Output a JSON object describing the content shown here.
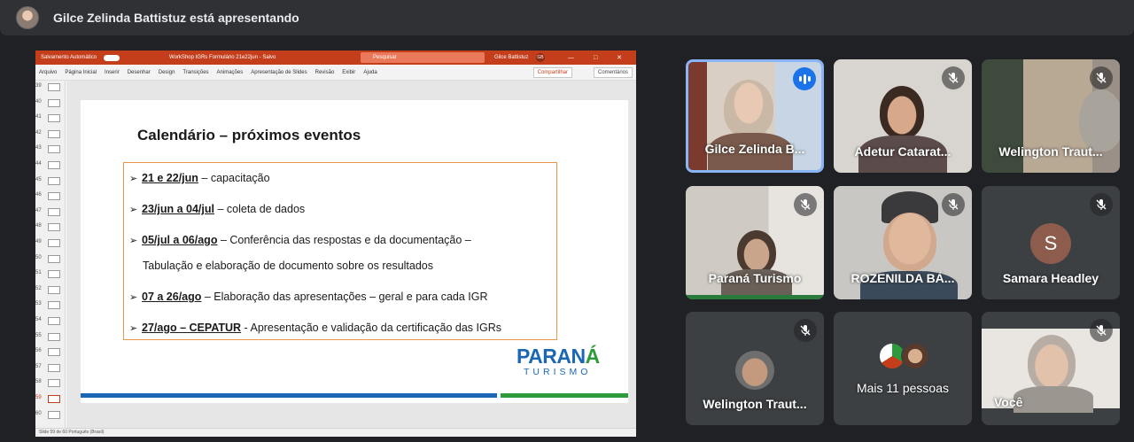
{
  "banner": {
    "presenter_text": "Gilce Zelinda Battistuz está apresentando"
  },
  "powerpoint": {
    "autosave_label": "Salvamento Automático",
    "filename": "WorkShop IGRs Formulário 21e22jun - Salvo",
    "search_placeholder": "Pesquisar",
    "user_name": "Gilce Battistuz",
    "user_initials": "GB",
    "window_buttons": "— □ ✕",
    "menu": [
      "Arquivo",
      "Página Inicial",
      "Inserir",
      "Desenhar",
      "Design",
      "Transições",
      "Animações",
      "Apresentação de Slides",
      "Revisão",
      "Exibir",
      "Ajuda"
    ],
    "share_label": "Compartilhar",
    "comments_label": "Comentários",
    "thumbnail_numbers": [
      "39",
      "40",
      "41",
      "42",
      "43",
      "44",
      "45",
      "46",
      "47",
      "48",
      "49",
      "50",
      "51",
      "52",
      "53",
      "54",
      "55",
      "56",
      "57",
      "58",
      "59",
      "60"
    ],
    "active_slide": "59",
    "status_text": "Slide 59 de 60    Português (Brasil)"
  },
  "slide": {
    "heading": "Calendário – próximos eventos",
    "items": [
      {
        "bold": "21 e 22/jun",
        "rest": " – capacitação"
      },
      {
        "bold": "23/jun a 04/jul",
        "rest": " – coleta de dados"
      },
      {
        "bold": "05/jul a 06/ago",
        "rest": " – Conferência das respostas e da documentação –"
      },
      {
        "bold": "",
        "rest": "Tabulação e elaboração de documento sobre os resultados"
      },
      {
        "bold": "07 a 26/ago",
        "rest": " – Elaboração das apresentações – geral e para cada IGR"
      },
      {
        "bold": "27/ago – CEPATUR",
        "rest": " - Apresentação e validação da certificação das IGRs"
      }
    ],
    "logo_top_a": "PARAN",
    "logo_top_b": "Á",
    "logo_bottom": "TURISMO"
  },
  "participants": [
    {
      "name": "Gilce Zelinda B...",
      "state": "speaking"
    },
    {
      "name": "Adetur Catarat...",
      "state": "muted"
    },
    {
      "name": "Welington Traut...",
      "state": "muted"
    },
    {
      "name": "Paraná Turismo",
      "state": "muted"
    },
    {
      "name": "ROZENILDA BÁ...",
      "state": "muted"
    },
    {
      "name": "Samara Headley",
      "state": "muted",
      "initial": "S"
    },
    {
      "name": "Welington Traut...",
      "state": "muted"
    },
    {
      "name": "Mais 11 pessoas",
      "state": "overflow"
    },
    {
      "name": "Você",
      "state": "muted"
    }
  ],
  "colors": {
    "meet_background": "#202124",
    "tile_background": "#3c4043",
    "speaking_border": "#8ab4f8",
    "ppt_accent": "#c43e1c",
    "slide_box_border": "#e8964c",
    "parana_blue": "#1b67b3",
    "parana_green": "#2e9b3b"
  }
}
